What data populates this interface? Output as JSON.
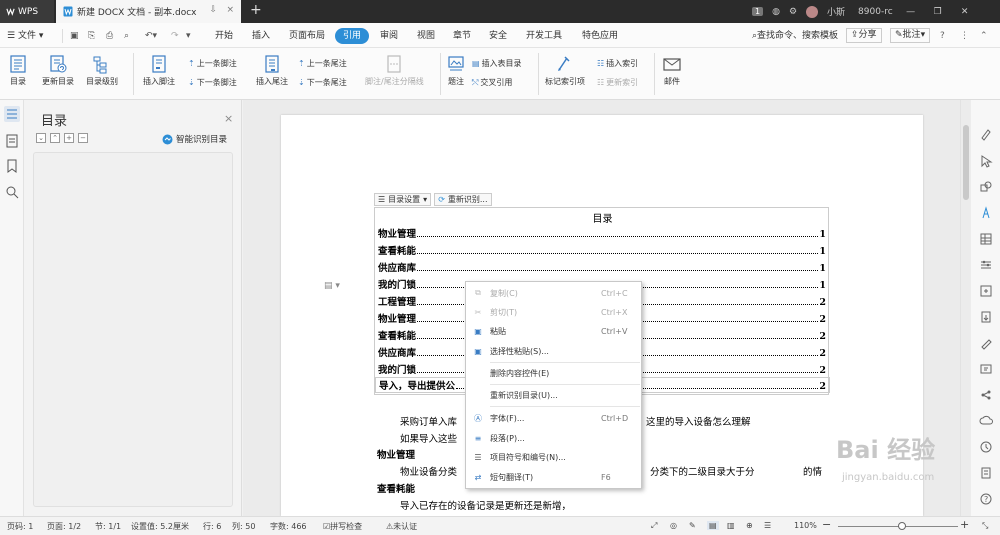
{
  "titlebar": {
    "app_tab": "WPS",
    "doc_tab": "新建 DOCX 文档 - 副本.docx",
    "doc_badge": "1",
    "user": "小斯",
    "user_id": "8900-rc"
  },
  "menubar": {
    "file": "文件",
    "items": [
      "开始",
      "插入",
      "页面布局",
      "引用",
      "审阅",
      "视图",
      "章节",
      "安全",
      "开发工具",
      "特色应用"
    ],
    "search": "查找命令、搜索模板",
    "share": "分享",
    "annotate": "批注"
  },
  "ribbon": {
    "toc": "目录",
    "update_toc": "更新目录",
    "toc_level": "目录级别",
    "insert_footnote": "插入脚注",
    "prev_footnote": "上一条脚注",
    "next_footnote": "下一条脚注",
    "insert_endnote": "插入尾注",
    "prev_endnote": "上一条尾注",
    "next_endnote": "下一条尾注",
    "separator": "脚注/尾注分隔线",
    "caption": "题注",
    "insert_table_toc": "插入表目录",
    "cross_ref": "交叉引用",
    "mark_index": "标记索引项",
    "insert_index": "插入索引",
    "update_index": "更新索引",
    "mail": "邮件"
  },
  "toc_panel": {
    "title": "目录",
    "close": "×",
    "smart": "智能识别目录"
  },
  "document": {
    "toc_settings": "目录设置",
    "re_identify": "重新识别...",
    "toc_heading": "目录",
    "toc_lines": [
      {
        "text": "物业管理",
        "page": "1"
      },
      {
        "text": "查看耗能",
        "page": "1"
      },
      {
        "text": "供应商库",
        "page": "1"
      },
      {
        "text": "我的门锁",
        "page": "1"
      },
      {
        "text": "工程管理",
        "page": "2"
      },
      {
        "text": "物业管理",
        "page": "2"
      },
      {
        "text": "查看耗能",
        "page": "2"
      },
      {
        "text": "供应商库",
        "page": "2"
      },
      {
        "text": "我的门锁",
        "page": "2"
      },
      {
        "text": "导入，导出提供公",
        "page": "2"
      }
    ],
    "body": {
      "l1a": "采购订单入库",
      "l1b": "这里的导入设备怎么理解",
      "l2": "如果导入这些",
      "h1": "物业管理",
      "l3a": "物业设备分类",
      "l3b": "分类下的二级目录大于分",
      "l3c": "的情",
      "h2": "查看耗能",
      "l4": "导入已存在的设备记录是更新还是新增，"
    }
  },
  "context_menu": {
    "items": [
      {
        "label": "复制(C)",
        "shortcut": "Ctrl+C",
        "disabled": true
      },
      {
        "label": "剪切(T)",
        "shortcut": "Ctrl+X",
        "disabled": true
      },
      {
        "label": "粘贴",
        "shortcut": "Ctrl+V",
        "disabled": false
      },
      {
        "label": "选择性粘贴(S)...",
        "shortcut": "",
        "disabled": false
      },
      {
        "label": "删除内容控件(E)",
        "shortcut": "",
        "disabled": false
      },
      {
        "label": "重新识别目录(U)...",
        "shortcut": "",
        "disabled": false
      },
      {
        "label": "字体(F)...",
        "shortcut": "Ctrl+D",
        "disabled": false
      },
      {
        "label": "段落(P)...",
        "shortcut": "",
        "disabled": false
      },
      {
        "label": "项目符号和编号(N)...",
        "shortcut": "",
        "disabled": false
      },
      {
        "label": "短句翻译(T)",
        "shortcut": "F6",
        "disabled": false
      }
    ]
  },
  "statusbar": {
    "page_no": "页码: 1",
    "pages": "页面: 1/2",
    "section": "节: 1/1",
    "setting": "设置值: 5.2厘米",
    "row": "行: 6",
    "col": "列: 50",
    "words": "字数: 466",
    "spell": "拼写检查",
    "cert": "未认证",
    "zoom": "110%",
    "zoom_minus": "−",
    "zoom_plus": "+"
  },
  "watermark": {
    "text": "Bai 经验",
    "sub": "jingyan.baidu.com"
  },
  "colors": {
    "accent": "#2d8ed6",
    "titlebar": "#2b2b2b",
    "canvas": "#ebebeb"
  }
}
